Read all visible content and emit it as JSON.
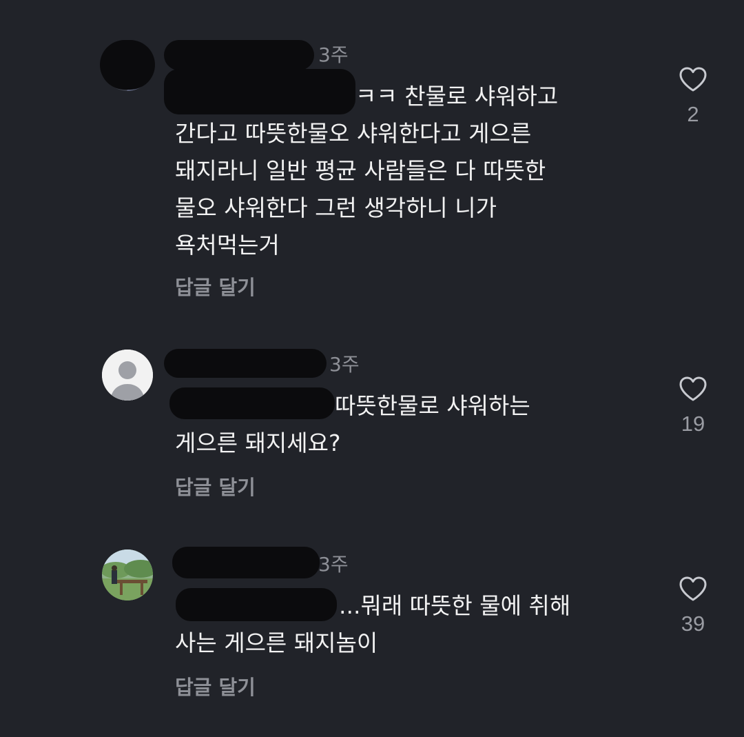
{
  "comments": [
    {
      "time": "3주",
      "text": "ㅋㅋ 찬물로 샤워하고\n간다고 따뜻한물오 샤워한다고 게으른\n돼지라니 일반 평균 사람들은 다 따뜻한\n물오 샤워한다 그런 생각하니 니가\n욕처먹는거",
      "reply_label": "답글 달기",
      "likes": "2"
    },
    {
      "time": "3주",
      "text": "따뜻한물로 샤워하는\n게으른 돼지세요?",
      "reply_label": "답글 달기",
      "likes": "19"
    },
    {
      "time": "3주",
      "text": "...뭐래 따뜻한 물에 취해\n사는 게으른 돼지놈이",
      "reply_label": "답글 달기",
      "likes": "39"
    }
  ],
  "colors": {
    "background": "#212329",
    "text": "#f2f2f2",
    "secondary": "#8e9097",
    "redaction": "#0b0b0d"
  },
  "icons": {
    "like": "heart-outline-icon",
    "default_avatar": "person-silhouette-icon"
  }
}
